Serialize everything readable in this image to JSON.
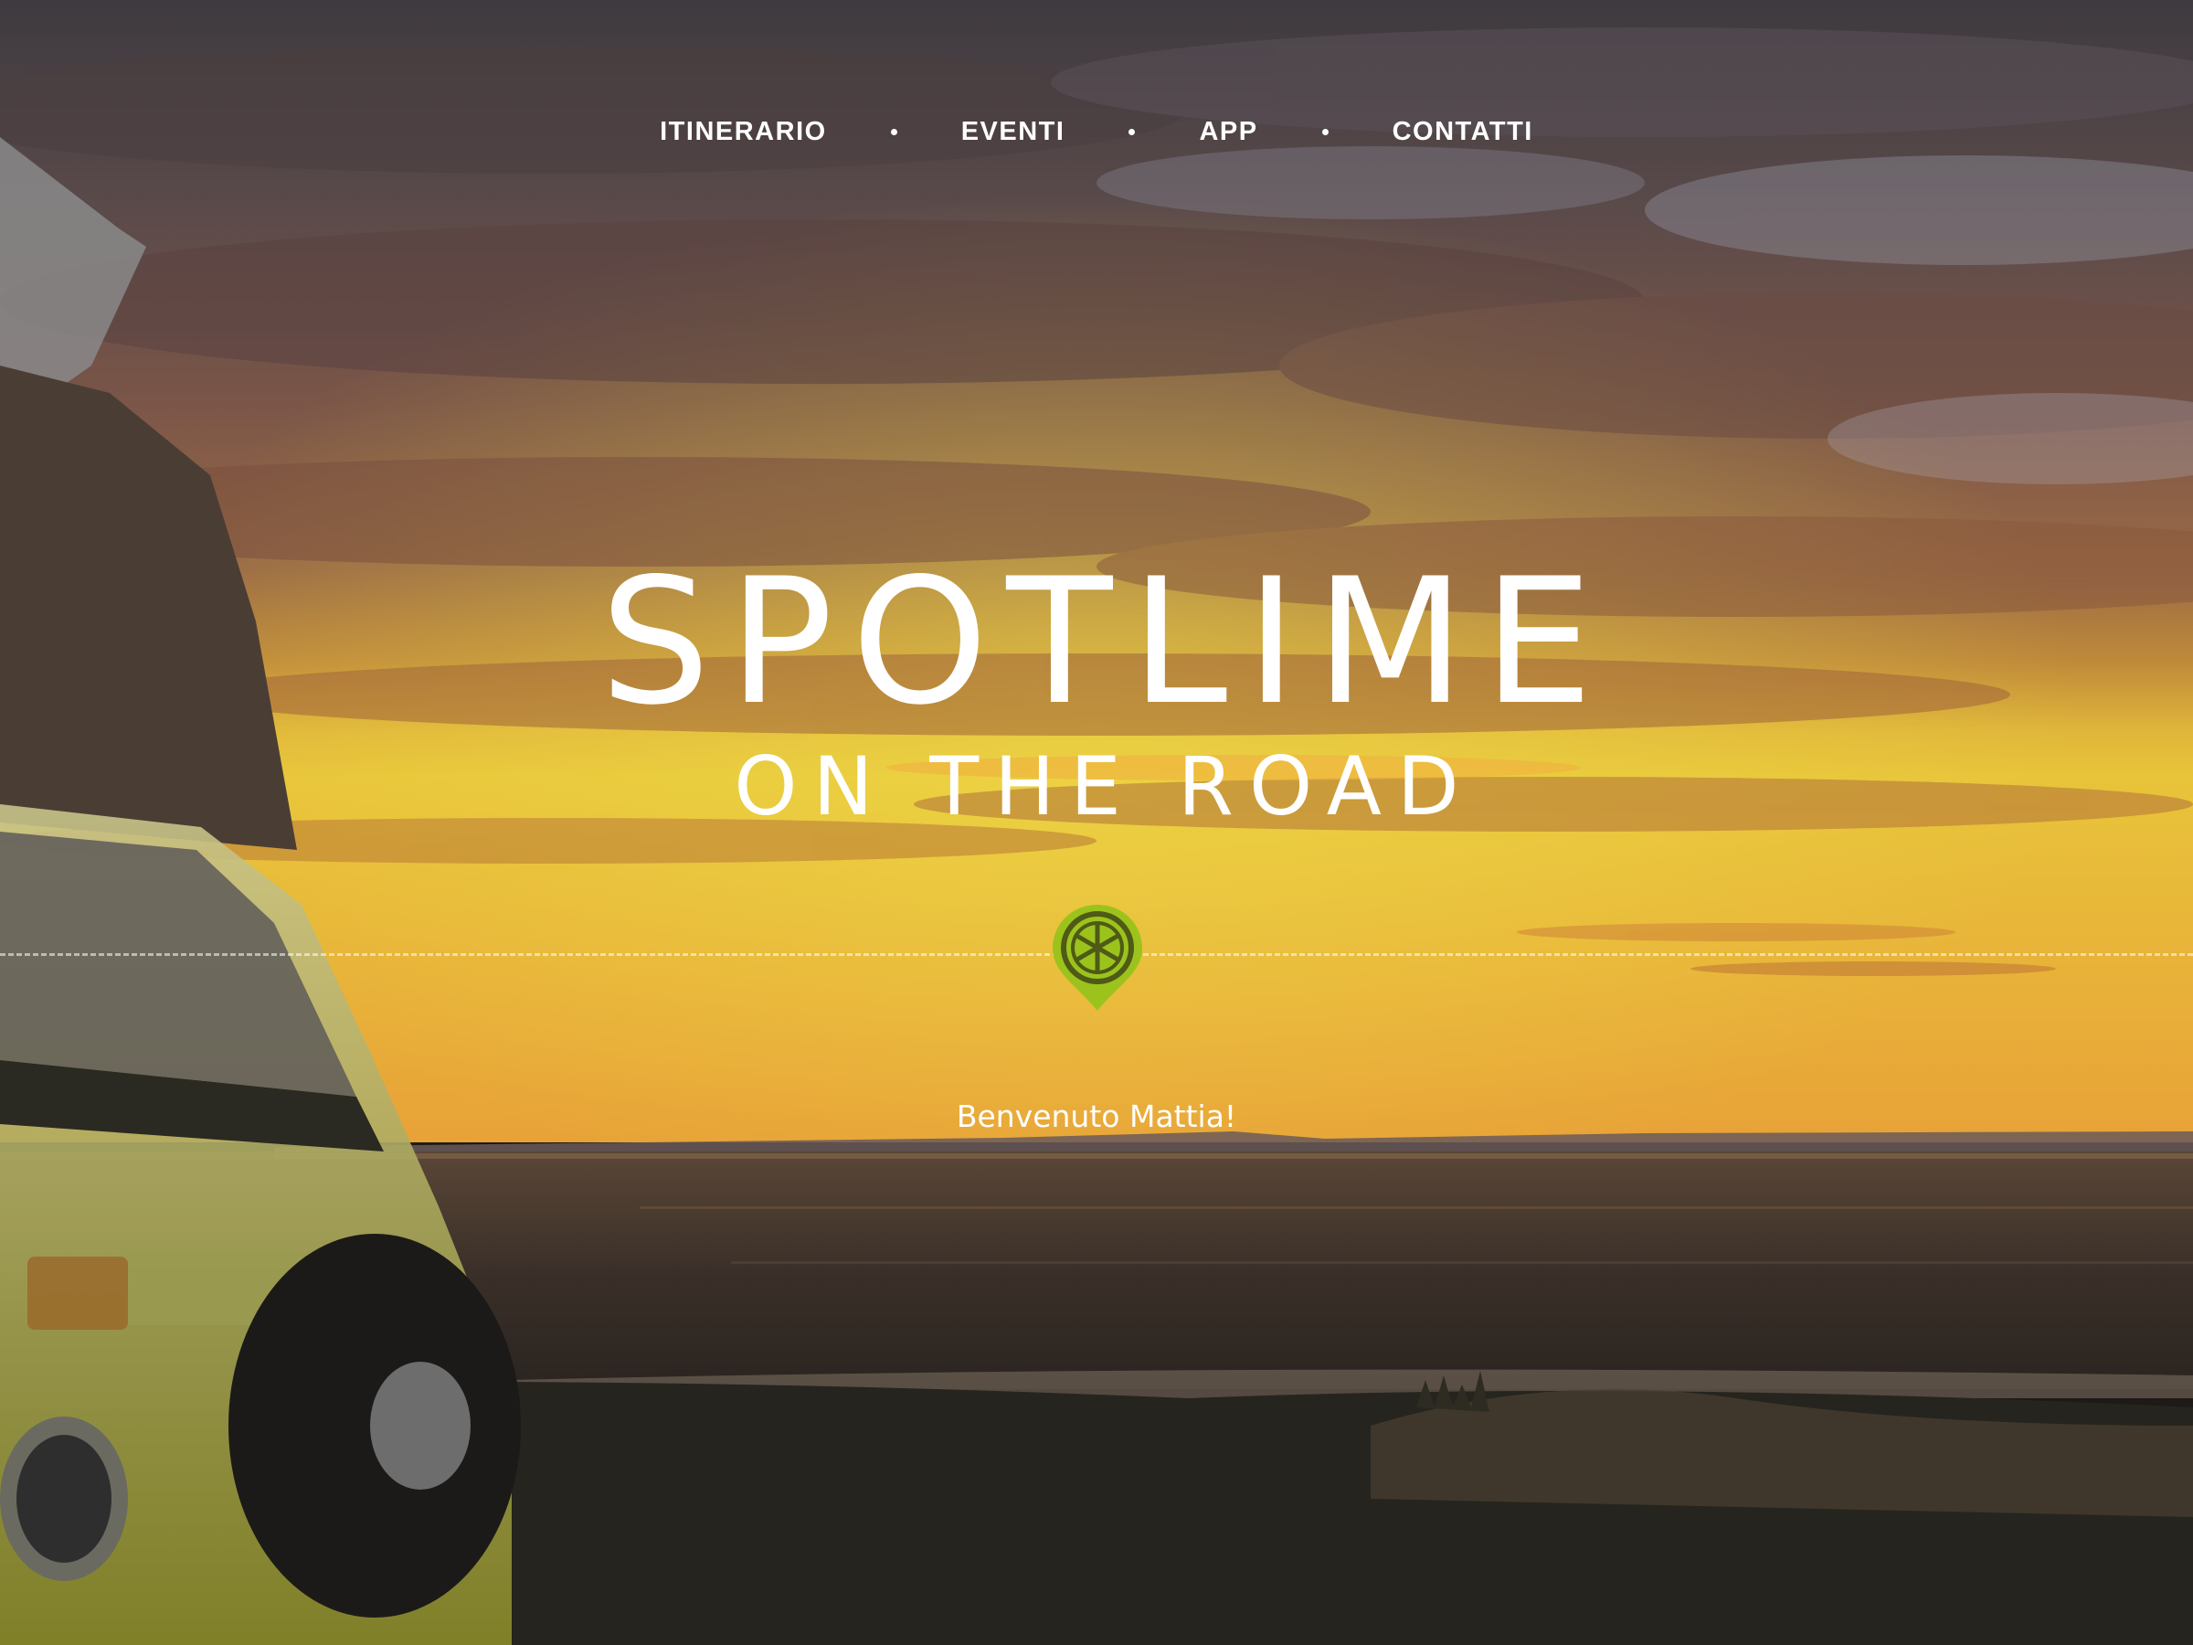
{
  "nav": {
    "items": [
      {
        "label": "ITINERARIO"
      },
      {
        "label": "EVENTI"
      },
      {
        "label": "APP"
      },
      {
        "label": "CONTATTI"
      }
    ]
  },
  "hero": {
    "title": "SPOTLIME",
    "subtitle": "ON THE ROAD",
    "welcome": "Benvenuto Mattia!",
    "pin_icon": "lime-map-pin-icon",
    "background_image": "sunset-over-sea-with-vintage-camper-van"
  },
  "colors": {
    "accent": "#9cc31c",
    "text": "#ffffff"
  }
}
